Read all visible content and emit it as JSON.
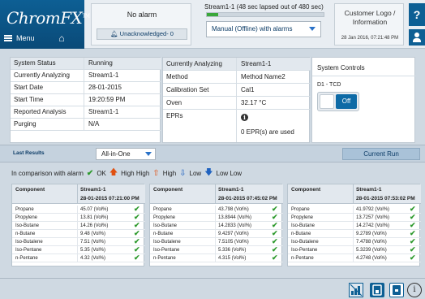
{
  "header": {
    "brand": "ChromFX",
    "brand_tm": "TM",
    "menu_label": "Menu",
    "alarm_status": "No alarm",
    "unacknowledged": "Unacknowledged- 0",
    "stream_status": "Stream1-1 (48 sec lapsed out of 480 sec)",
    "progress_fraction": 0.1,
    "mode": "Manual (Offline) with alarms",
    "customer_logo": "Customer Logo / Information",
    "datetime": "28 Jan 2016, 07:21:48 PM",
    "help_label": "?"
  },
  "status": {
    "header_key": "System Status",
    "header_value": "Running",
    "rows": [
      {
        "k": "Currently Analyzing",
        "v": "Stream1-1"
      },
      {
        "k": "Start Date",
        "v": "28-01-2015"
      },
      {
        "k": "Start Time",
        "v": "19:20:59 PM"
      },
      {
        "k": "Reported Analysis",
        "v": "Stream1-1"
      },
      {
        "k": "Purging",
        "v": "N/A"
      }
    ]
  },
  "analyzing": {
    "header_key": "Currently Analyzing",
    "header_value": "Stream1-1",
    "rows": [
      {
        "k": "Method",
        "v": "Method Name2"
      },
      {
        "k": "Calibration Set",
        "v": "Cal1"
      },
      {
        "k": "Oven",
        "v": "32.17 °C"
      },
      {
        "k": "EPRs",
        "v": ""
      }
    ],
    "epr_count": "0 EPR(s) are used",
    "info_glyph": "i"
  },
  "controls": {
    "title": "System Controls",
    "detector": "D1 - TCD",
    "toggle_label": "Off"
  },
  "results": {
    "title": "Last Results",
    "view": "All-in-One",
    "current_run": "Current Run"
  },
  "legend": {
    "intro": "In comparison with alarm",
    "ok": "OK",
    "high_high": "High High",
    "high": "High",
    "low": "Low",
    "low_low": "Low Low"
  },
  "grids": [
    {
      "component_label": "Component",
      "stream": "Stream1-1",
      "date": "28-01-2015 07:21:00 PM",
      "rows": [
        {
          "c": "Propane",
          "v": "45.07 (Vol%)"
        },
        {
          "c": "Propylene",
          "v": "13.81 (Vol%)"
        },
        {
          "c": "Iso-Butane",
          "v": "14.26 (Vol%)"
        },
        {
          "c": "n-Butane",
          "v": "9.48 (Vol%)"
        },
        {
          "c": "Iso-Butalene",
          "v": "7.51 (Vol%)"
        },
        {
          "c": "Iso-Pentane",
          "v": "5.35 (Vol%)"
        },
        {
          "c": "n-Pentane",
          "v": "4.32 (Vol%)"
        }
      ]
    },
    {
      "component_label": "Component",
      "stream": "Stream1-1",
      "date": "28-01-2015 07:45:02 PM",
      "rows": [
        {
          "c": "Propane",
          "v": "43.798 (Vol%)"
        },
        {
          "c": "Propylene",
          "v": "13.8944 (Vol%)"
        },
        {
          "c": "Iso-Butane",
          "v": "14.2833 (Vol%)"
        },
        {
          "c": "n-Butane",
          "v": "9.4297 (Vol%)"
        },
        {
          "c": "Iso-Butalene",
          "v": "7.5105 (Vol%)"
        },
        {
          "c": "Iso-Pentane",
          "v": "5.336 (Vol%)"
        },
        {
          "c": "n-Pentane",
          "v": "4.315 (Vol%)"
        }
      ]
    },
    {
      "component_label": "Component",
      "stream": "Stream1-1",
      "date": "28-01-2015 07:53:02 PM",
      "rows": [
        {
          "c": "Propane",
          "v": "41.9792 (Vol%)"
        },
        {
          "c": "Propylene",
          "v": "13.7257 (Vol%)"
        },
        {
          "c": "Iso-Butane",
          "v": "14.2742 (Vol%)"
        },
        {
          "c": "n-Butane",
          "v": "9.2789 (Vol%)"
        },
        {
          "c": "Iso-Butalene",
          "v": "7.4788 (Vol%)"
        },
        {
          "c": "Iso-Pentane",
          "v": "5.3239 (Vol%)"
        },
        {
          "c": "n-Pentane",
          "v": "4.2748 (Vol%)"
        }
      ]
    }
  ],
  "colors": {
    "brand_blue": "#0d5f94",
    "ok_green": "#2e9a2e",
    "high_orange": "#e05010",
    "low_blue": "#1f62c0"
  },
  "footer": {
    "icons": [
      "chart-icon",
      "save-icon",
      "report-icon",
      "info-icon"
    ],
    "info_glyph": "i"
  }
}
